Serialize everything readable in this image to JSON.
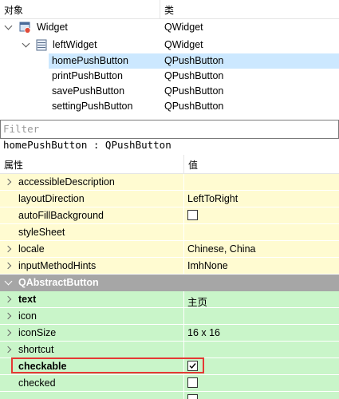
{
  "object_inspector": {
    "header": {
      "object_col": "对象",
      "class_col": "类"
    },
    "rows": [
      {
        "name": "Widget",
        "cls": "QWidget"
      },
      {
        "name": "leftWidget",
        "cls": "QWidget"
      },
      {
        "name": "homePushButton",
        "cls": "QPushButton"
      },
      {
        "name": "printPushButton",
        "cls": "QPushButton"
      },
      {
        "name": "savePushButton",
        "cls": "QPushButton"
      },
      {
        "name": "settingPushButton",
        "cls": "QPushButton"
      }
    ]
  },
  "filter": {
    "placeholder": "Filter",
    "value": ""
  },
  "current_object": "homePushButton : QPushButton",
  "property_editor": {
    "header": {
      "property_col": "属性",
      "value_col": "值"
    },
    "rows": [
      {
        "name": "accessibleDescription",
        "value": ""
      },
      {
        "name": "layoutDirection",
        "value": "LeftToRight"
      },
      {
        "name": "autoFillBackground",
        "checked": false
      },
      {
        "name": "styleSheet",
        "value": ""
      },
      {
        "name": "locale",
        "value": "Chinese, China"
      },
      {
        "name": "inputMethodHints",
        "value": "ImhNone"
      }
    ],
    "group": "QAbstractButton",
    "button_rows": [
      {
        "name": "text",
        "value": "主页"
      },
      {
        "name": "icon",
        "value": ""
      },
      {
        "name": "iconSize",
        "value": "16 x 16"
      },
      {
        "name": "shortcut",
        "value": ""
      },
      {
        "name": "checkable",
        "checked": true
      },
      {
        "name": "checked",
        "checked": false
      }
    ]
  },
  "colors": {
    "selection": "#cce8ff",
    "widget_rows": "#fffbd1",
    "button_rows": "#c9f5c9",
    "group": "#a6a6a6",
    "highlight": "#e53935"
  }
}
